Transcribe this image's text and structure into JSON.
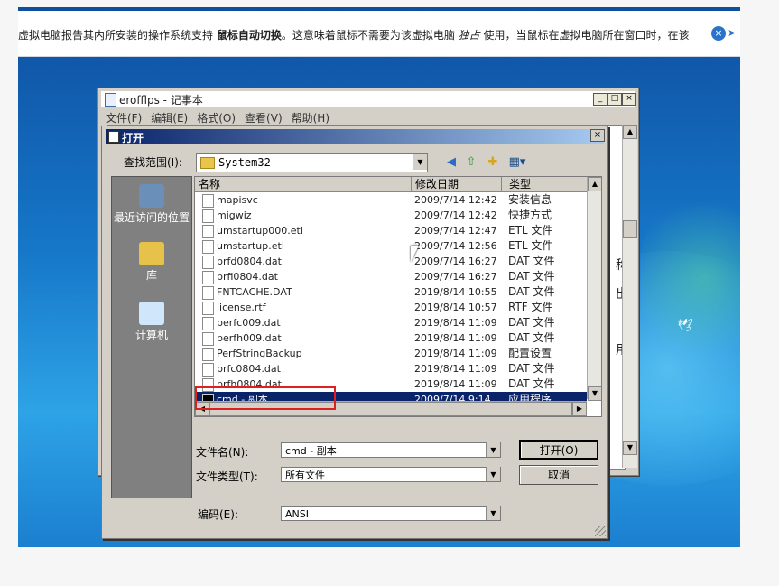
{
  "notification": {
    "text_before": "虚拟电脑报告其内所安装的操作系统支持 ",
    "bold_text": "鼠标自动切换",
    "text_middle": "。这意味着鼠标不需要为该虚拟电脑 ",
    "italic_text": "独占",
    "text_after": " 使用，当鼠标在虚拟电脑所在窗口时，在该",
    "close_icon": "close-circle-icon"
  },
  "notepad": {
    "title": "erofflps - 记事本",
    "menu": [
      "文件(F)",
      "编辑(E)",
      "格式(O)",
      "查看(V)",
      "帮助(H)"
    ],
    "minimize": "_",
    "maximize": "□",
    "close": "×",
    "visible_fragments": [
      "称",
      "出",
      "用"
    ]
  },
  "dialog": {
    "title": "打开",
    "close": "×",
    "look_in_label": "查找范围(I):",
    "look_in_value": "System32",
    "places": [
      {
        "label": "最近访问的位置",
        "icon": "recent-places-icon"
      },
      {
        "label": "库",
        "icon": "library-icon"
      },
      {
        "label": "计算机",
        "icon": "computer-icon"
      }
    ],
    "columns": [
      "名称",
      "修改日期",
      "类型"
    ],
    "files": [
      {
        "name": "mapisvc",
        "date": "2009/7/14 12:42",
        "type": "安装信息"
      },
      {
        "name": "migwiz",
        "date": "2009/7/14 12:42",
        "type": "快捷方式"
      },
      {
        "name": "umstartup000.etl",
        "date": "2009/7/14 12:47",
        "type": "ETL 文件"
      },
      {
        "name": "umstartup.etl",
        "date": "2009/7/14 12:56",
        "type": "ETL 文件"
      },
      {
        "name": "prfd0804.dat",
        "date": "2009/7/14 16:27",
        "type": "DAT 文件"
      },
      {
        "name": "prfi0804.dat",
        "date": "2009/7/14 16:27",
        "type": "DAT 文件"
      },
      {
        "name": "FNTCACHE.DAT",
        "date": "2019/8/14 10:55",
        "type": "DAT 文件"
      },
      {
        "name": "license.rtf",
        "date": "2019/8/14 10:57",
        "type": "RTF 文件"
      },
      {
        "name": "perfc009.dat",
        "date": "2019/8/14 11:09",
        "type": "DAT 文件"
      },
      {
        "name": "perfh009.dat",
        "date": "2019/8/14 11:09",
        "type": "DAT 文件"
      },
      {
        "name": "PerfStringBackup",
        "date": "2019/8/14 11:09",
        "type": "配置设置"
      },
      {
        "name": "prfc0804.dat",
        "date": "2019/8/14 11:09",
        "type": "DAT 文件"
      },
      {
        "name": "prfh0804.dat",
        "date": "2019/8/14 11:09",
        "type": "DAT 文件"
      },
      {
        "name": "cmd - 副本",
        "date": "2009/7/14 9:14",
        "type": "应用程序"
      }
    ],
    "filename_label": "文件名(N):",
    "filename_value": "cmd - 副本",
    "filetype_label": "文件类型(T):",
    "filetype_value": "所有文件",
    "encoding_label": "编码(E):",
    "encoding_value": "ANSI",
    "open_button": "打开(O)",
    "cancel_button": "取消"
  }
}
